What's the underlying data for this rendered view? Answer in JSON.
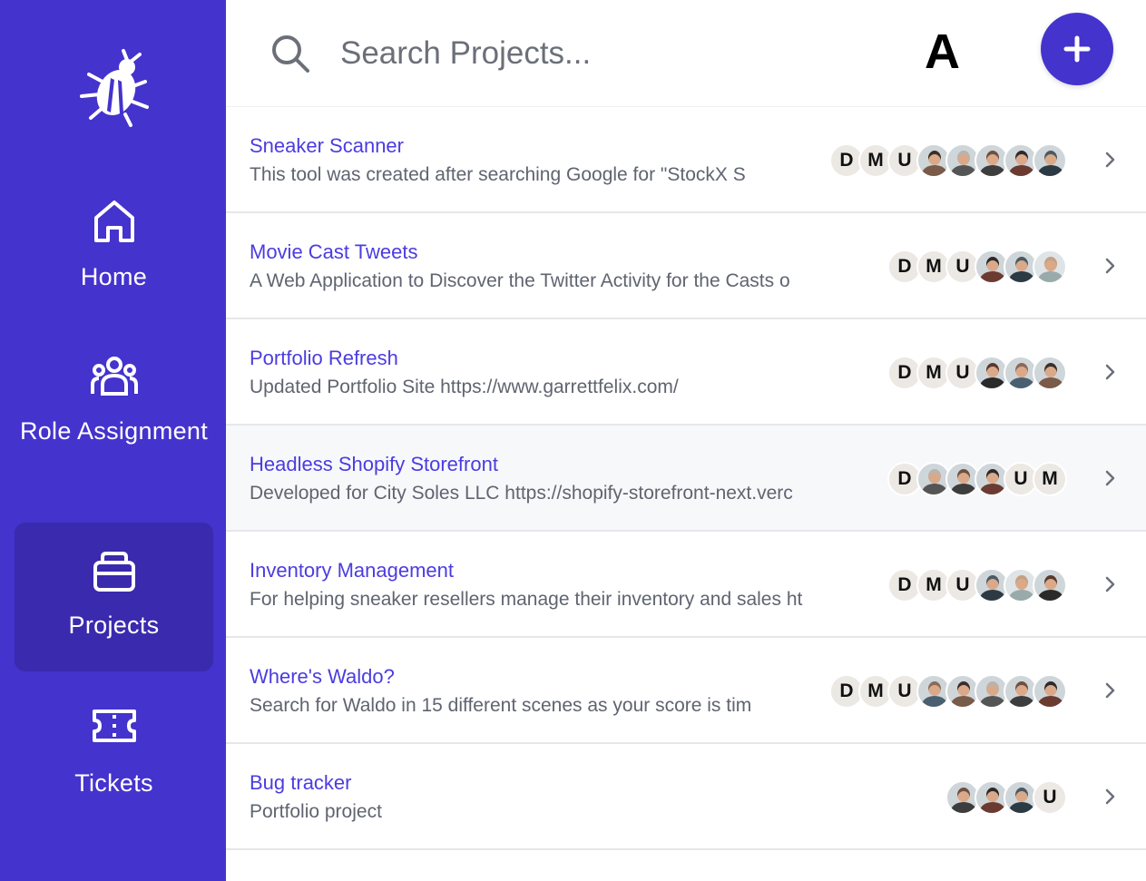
{
  "sidebar": {
    "logo_icon": "bug-icon",
    "items": [
      {
        "label": "Home",
        "icon": "home-icon"
      },
      {
        "label": "Role Assignment",
        "icon": "users-group-icon"
      },
      {
        "label": "Projects",
        "icon": "briefcase-icon",
        "active": true
      },
      {
        "label": "Tickets",
        "icon": "ticket-icon"
      }
    ]
  },
  "header": {
    "search_placeholder": "Search Projects...",
    "user_initial": "A",
    "add_icon": "plus-icon"
  },
  "projects": [
    {
      "title": "Sneaker Scanner",
      "description": "This tool was created after searching Google for \"StockX S",
      "members": [
        "D",
        "M",
        "U",
        "photo",
        "photo",
        "photo",
        "photo",
        "photo"
      ]
    },
    {
      "title": "Movie Cast Tweets",
      "description": "A Web Application to Discover the Twitter Activity for the Casts o",
      "members": [
        "D",
        "M",
        "U",
        "photo",
        "photo",
        "photo"
      ]
    },
    {
      "title": "Portfolio Refresh",
      "description": "Updated Portfolio Site https://www.garrettfelix.com/",
      "members": [
        "D",
        "M",
        "U",
        "photo",
        "photo",
        "photo"
      ]
    },
    {
      "title": "Headless Shopify Storefront",
      "description": "Developed for City Soles LLC https://shopify-storefront-next.verc",
      "members": [
        "D",
        "photo",
        "photo",
        "photo",
        "U",
        "M"
      ]
    },
    {
      "title": "Inventory Management",
      "description": "For helping sneaker resellers manage their inventory and sales ht",
      "members": [
        "D",
        "M",
        "U",
        "photo",
        "photo",
        "photo"
      ]
    },
    {
      "title": "Where's Waldo?",
      "description": "Search for Waldo in 15 different scenes as your score is tim",
      "members": [
        "D",
        "M",
        "U",
        "photo",
        "photo",
        "photo",
        "photo",
        "photo"
      ]
    },
    {
      "title": "Bug tracker",
      "description": "Portfolio project",
      "members": [
        "photo",
        "photo",
        "photo",
        "U"
      ]
    }
  ],
  "colors": {
    "sidebar_bg": "#4433cc",
    "active_item_bg": "#3a2aad",
    "title_link": "#4b3ce0",
    "add_button": "#4433cc"
  }
}
